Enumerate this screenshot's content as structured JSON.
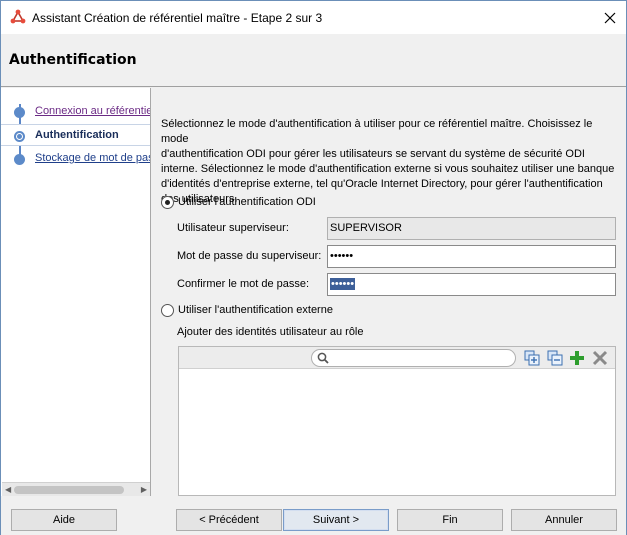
{
  "window": {
    "title": "Assistant Création de référentiel maître - Etape 2 sur 3",
    "icon": "odi-app-icon",
    "close_icon": "close-icon"
  },
  "header": {
    "title": "Authentification"
  },
  "nav": {
    "items": [
      {
        "label": "Connexion au référentiel maître",
        "state": "visited"
      },
      {
        "label": "Authentification",
        "state": "active"
      },
      {
        "label": "Stockage de mot de passe",
        "state": "link"
      }
    ]
  },
  "content": {
    "intro_lines": [
      "Sélectionnez le mode d'authentification à utiliser pour ce référentiel maître. Choisissez le mode",
      "d'authentification ODI pour gérer les utilisateurs se servant du système de sécurité ODI",
      "interne. Sélectionnez le mode d'authentification externe si vous souhaitez utiliser une banque",
      "d'identités d'entreprise externe, tel qu'Oracle Internet Directory, pour gérer l'authentification",
      "des utilisateurs."
    ],
    "odi_auth": {
      "label": "Utiliser l'authentification ODI",
      "selected": true,
      "supervisor_user_label": "Utilisateur superviseur:",
      "supervisor_user_value": "SUPERVISOR",
      "password_label": "Mot de passe du superviseur:",
      "password_value": "••••••",
      "confirm_label": "Confirmer le mot de passe:",
      "confirm_value": "••••••"
    },
    "external_auth": {
      "label": "Utiliser l'authentification externe",
      "selected": false,
      "role_label": "Ajouter des identités utilisateur au rôle",
      "search_value": "",
      "toolbar_icons": [
        "add-multiple-icon",
        "remove-multiple-icon",
        "add-icon",
        "delete-icon"
      ]
    }
  },
  "footer": {
    "help": "Aide",
    "back": "< Précédent",
    "next": "Suivant >",
    "finish": "Fin",
    "cancel": "Annuler"
  },
  "colors": {
    "accent": "#5c8ac9",
    "selection": "#3d5f99",
    "add_green": "#2e9e2e",
    "visited_link": "#6b2a85"
  }
}
